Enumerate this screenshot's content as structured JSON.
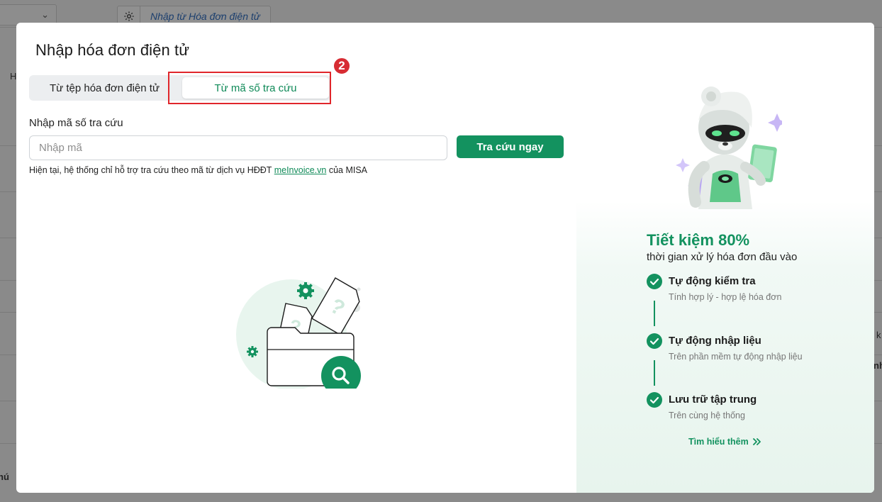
{
  "background": {
    "tab_label": "Nhập từ Hóa đơn điện tử",
    "side_letter": "H",
    "right_letter_1": "k",
    "right_letter_2": "nh",
    "bottom_left_text": "hú"
  },
  "modal": {
    "title": "Nhập hóa đơn điện tử",
    "tabs": [
      {
        "label": "Từ tệp hóa đơn điện tử",
        "active": false
      },
      {
        "label": "Từ mã số tra cứu",
        "active": true
      }
    ],
    "step_badge": "2",
    "field_label": "Nhập mã số tra cứu",
    "input": {
      "placeholder": "Nhập mã",
      "value": ""
    },
    "search_button": "Tra cứu ngay",
    "note": {
      "prefix": "Hiện tại, hệ thống chỉ hỗ trợ tra cứu theo mã từ dịch vụ HĐĐT ",
      "link": "meInvoice.vn",
      "suffix": " của MISA"
    }
  },
  "promo": {
    "title": "Tiết kiệm 80%",
    "subtitle": "thời gian xử lý hóa đơn đầu vào",
    "features": [
      {
        "title": "Tự động kiểm tra",
        "desc": "Tính hợp lý - hợp lệ hóa đơn"
      },
      {
        "title": "Tự động nhập liệu",
        "desc": "Trên phần mềm tự động nhập liệu"
      },
      {
        "title": "Lưu trữ tập trung",
        "desc": "Trên cùng hệ thống"
      }
    ],
    "learn_more": "Tìm hiểu thêm"
  },
  "colors": {
    "accent": "#13925f",
    "highlight": "#e0262b",
    "badge": "#d72c33"
  }
}
